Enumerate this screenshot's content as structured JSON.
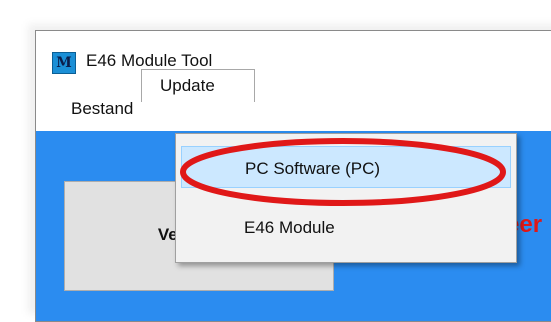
{
  "window": {
    "title": "E46 Module Tool",
    "icon_letter": "M"
  },
  "menubar": {
    "items": [
      {
        "label": "Bestand"
      },
      {
        "label": "Update"
      }
    ]
  },
  "dropdown": {
    "items": [
      {
        "label": "PC Software (PC)",
        "highlighted": true
      },
      {
        "label": "E46 Module",
        "highlighted": false
      }
    ]
  },
  "main": {
    "connect_label": "Verbinden",
    "status_text_partial": "eer"
  },
  "colors": {
    "window_background": "#2b8cf0",
    "highlight": "#cce8ff",
    "annotation_ellipse": "#e01818",
    "status_text": "#e01818"
  }
}
